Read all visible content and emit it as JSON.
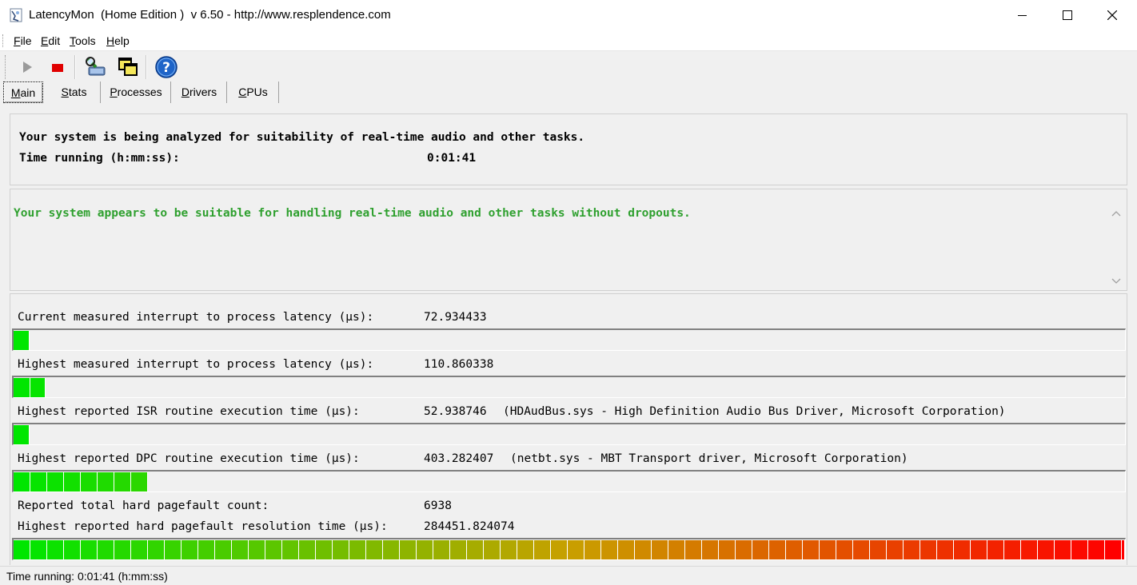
{
  "window": {
    "title": "LatencyMon  (Home Edition )  v 6.50 - http://www.resplendence.com"
  },
  "menu": {
    "items": [
      {
        "accel": "F",
        "rest": "ile"
      },
      {
        "accel": "E",
        "rest": "dit"
      },
      {
        "accel": "T",
        "rest": "ools"
      },
      {
        "accel": "H",
        "rest": "elp"
      }
    ]
  },
  "toolbar": {
    "buttons": [
      "play-icon",
      "stop-icon",
      "analyze-icon",
      "windows-icon",
      "help-icon"
    ],
    "colors": {
      "stop": "#e00000",
      "help": "#1e64c8"
    }
  },
  "tabs": [
    {
      "accel": "M",
      "rest": "ain",
      "active": true
    },
    {
      "accel": "S",
      "rest": "tats",
      "active": false
    },
    {
      "accel": "P",
      "rest": "rocesses",
      "active": false
    },
    {
      "accel": "D",
      "rest": "rivers",
      "active": false
    },
    {
      "accel": "C",
      "rest": "PUs",
      "active": false
    }
  ],
  "analysis": {
    "line1": "Your system is being analyzed for suitability of real-time audio and other tasks.",
    "time_label": "Time running (h:mm:ss):",
    "time_value": "0:01:41"
  },
  "result": {
    "text": "Your system appears to be suitable for handling real-time audio and other tasks without dropouts.",
    "color": "#2fa02f"
  },
  "metrics": [
    {
      "label": "Current measured interrupt to process latency (µs):",
      "value": "72.934433",
      "extra": "",
      "bar_fraction": 0.0132
    },
    {
      "label": "Highest measured interrupt to process latency (µs):",
      "value": "110.860338",
      "extra": "",
      "bar_fraction": 0.0287
    },
    {
      "label": "Highest reported ISR routine execution time (µs):",
      "value": "52.938746",
      "extra": "(HDAudBus.sys - High Definition Audio Bus Driver, Microsoft Corporation)",
      "bar_fraction": 0.0132
    },
    {
      "label": "Highest reported DPC routine execution time (µs):",
      "value": "403.282407",
      "extra": "(netbt.sys - MBT Transport driver, Microsoft Corporation)",
      "bar_fraction": 0.1206
    },
    {
      "label": "Reported total hard pagefault count:",
      "value": "6938",
      "extra": "",
      "bar_fraction": null
    },
    {
      "label": "Highest reported hard pagefault resolution time (µs):",
      "value": "284451.824074",
      "extra": "",
      "bar_fraction": 1.0
    }
  ],
  "status": {
    "text": "Time running: 0:01:41  (h:mm:ss)"
  }
}
